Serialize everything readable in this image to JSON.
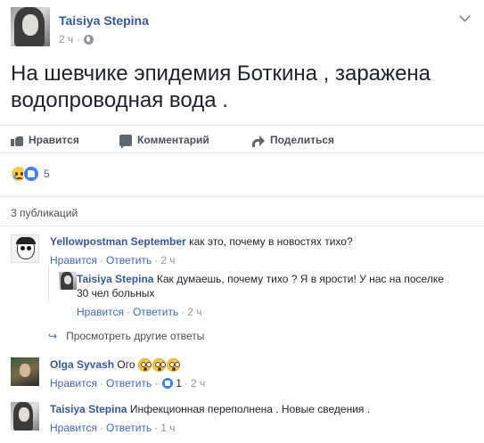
{
  "post": {
    "author": "Taisiya Stepina",
    "time": "2 ч",
    "privacy_separator": "·",
    "text": "На шевчике эпидемия Боткина , заражена водопроводная вода ."
  },
  "actions": {
    "like": "Нравится",
    "comment": "Комментарий",
    "share": "Поделиться"
  },
  "reactions": {
    "count": "5",
    "types": [
      "sad",
      "like"
    ]
  },
  "comments_section": {
    "publications_count": "3 публикаций",
    "view_more_replies": "Просмотреть другие ответы"
  },
  "comments": [
    {
      "author": "Yellowpostman September",
      "text": "как это, почему в новостях тихо?",
      "like": "Нравится",
      "reply": "Ответить",
      "time": "2 ч",
      "replies": [
        {
          "author": "Taisiya Stepina",
          "text": "Как думаешь, почему тихо ? Я в ярости! У нас на поселке 30 чел больных",
          "like": "Нравится",
          "reply": "Ответить",
          "time": "2 ч"
        }
      ]
    },
    {
      "author": "Olga Syvash",
      "text": "Ого",
      "emoji": [
        "astonished",
        "astonished",
        "astonished"
      ],
      "like": "Нравится",
      "reply": "Ответить",
      "likes_count": "1",
      "time": "2 ч"
    },
    {
      "author": "Taisiya Stepina",
      "text": "Инфекционная переполнена . Новые сведения .",
      "like": "Нравится",
      "reply": "Ответить",
      "time": "1 ч"
    }
  ],
  "colors": {
    "link_blue": "#365899",
    "action_blue": "#4267b2",
    "meta_gray": "#90949c",
    "text_dark": "#1d2129",
    "like_blue": "#3d7ef1"
  }
}
